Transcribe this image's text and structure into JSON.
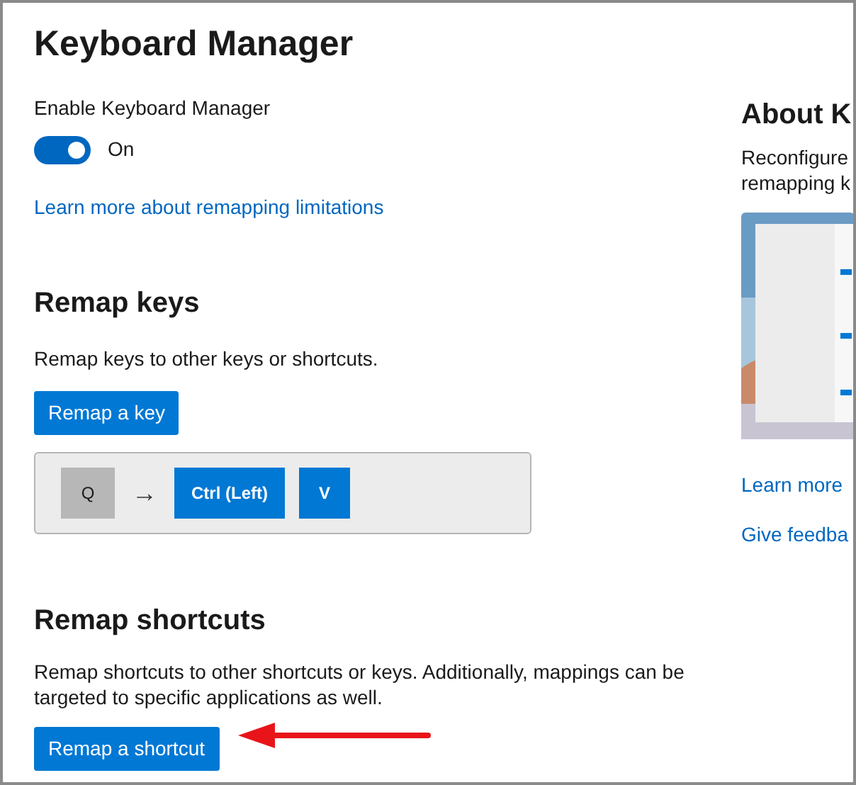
{
  "title": "Keyboard Manager",
  "enable": {
    "label": "Enable Keyboard Manager",
    "on": true,
    "state_text": "On"
  },
  "limitations_link": "Learn more about remapping limitations",
  "remap_keys": {
    "heading": "Remap keys",
    "description": "Remap keys to other keys or shortcuts.",
    "button": "Remap a key",
    "mapping": {
      "from": [
        {
          "label": "Q"
        }
      ],
      "arrow": "→",
      "to": [
        {
          "label": "Ctrl (Left)"
        },
        {
          "label": "V"
        }
      ]
    }
  },
  "remap_shortcuts": {
    "heading": "Remap shortcuts",
    "description": "Remap shortcuts to other shortcuts or keys. Additionally, mappings can be targeted to specific applications as well.",
    "button": "Remap a shortcut"
  },
  "about": {
    "heading": "About K",
    "description_lines": [
      "Reconfigure",
      "remapping k"
    ],
    "links": [
      "Learn more",
      "Give feedba"
    ]
  }
}
